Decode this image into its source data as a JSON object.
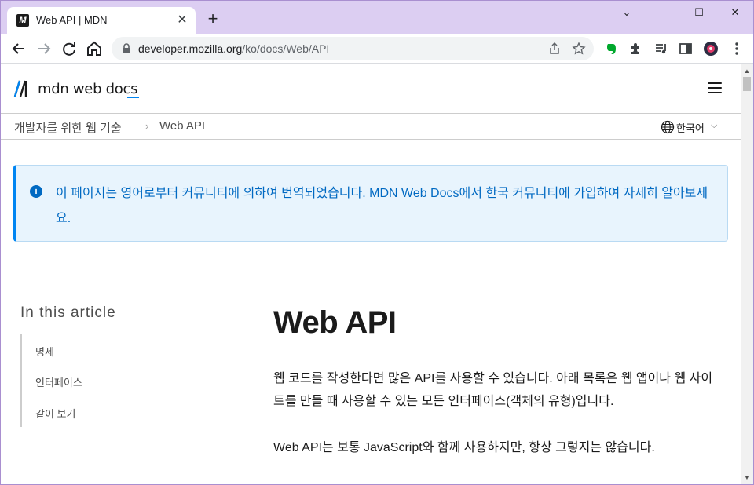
{
  "browser": {
    "tab_title": "Web API | MDN",
    "favicon_label": "M",
    "url_host": "developer.mozilla.org",
    "url_path": "/ko/docs/Web/API",
    "window_controls": {
      "minimize": "—",
      "maximize": "☐",
      "close": "✕",
      "tab_search": "⌄"
    }
  },
  "mdn": {
    "logo_text": "mdn web docs",
    "breadcrumbs": [
      "개발자를 위한 웹 기술",
      "Web API"
    ],
    "breadcrumb_separator": "›",
    "language": "한국어",
    "notice": "이 페이지는 영어로부터 커뮤니티에 의하여 번역되었습니다. MDN Web Docs에서 한국 커뮤니티에 가입하여 자세히 알아보세요.",
    "toc": {
      "title": "In this article",
      "items": [
        "명세",
        "인터페이스",
        "같이 보기"
      ]
    },
    "title": "Web API",
    "paragraphs": [
      "웹 코드를 작성한다면 많은 API를 사용할 수 있습니다. 아래 목록은 웹 앱이나 웹 사이트를 만들 때 사용할 수 있는 모든 인터페이스(객체의 유형)입니다.",
      "Web API는 보통 JavaScript와 함께 사용하지만, 항상 그렇지는 않습니다."
    ]
  },
  "colors": {
    "tabstrip": "#dccef2",
    "accent": "#0085f2",
    "notice_text": "#0069c2"
  },
  "icons": [
    "back-icon",
    "forward-icon",
    "reload-icon",
    "home-icon",
    "lock-icon",
    "share-icon",
    "star-icon",
    "evernote-icon",
    "extensions-icon",
    "media-icon",
    "sidepanel-icon",
    "profile-icon",
    "kebab-menu-icon",
    "hamburger-icon",
    "globe-icon",
    "info-icon"
  ]
}
